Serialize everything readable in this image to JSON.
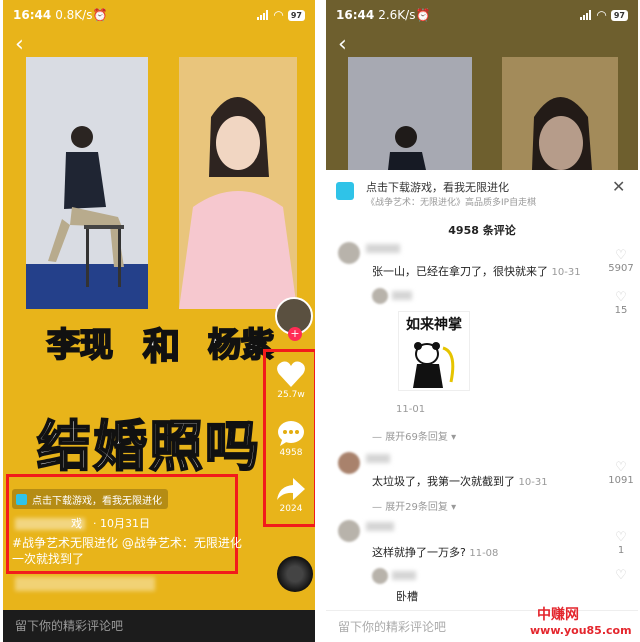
{
  "left": {
    "status": {
      "time": "16:44",
      "speed": "0.8K/s",
      "battery": "97"
    },
    "overlay": {
      "name_a": "李现",
      "and": "和",
      "name_b": "杨紫",
      "title": "结婚照吗"
    },
    "actions": {
      "likes": "25.7w",
      "comments": "4958",
      "shares": "2024"
    },
    "promo": "点击下载游戏，看我无限进化",
    "author_suffix": "戏",
    "date": "· 10月31日",
    "caption_line1": "#战争艺术无限进化 @战争艺术：无限进化",
    "caption_line2": "一次就找到了",
    "comment_placeholder": "留下你的精彩评论吧",
    "colors": {
      "video_bg": "#e3ad10",
      "highlight": "#f21b1b"
    }
  },
  "right": {
    "status": {
      "time": "16:44",
      "speed": "2.6K/s",
      "battery": "97"
    },
    "promo_title": "点击下载游戏，看我无限进化",
    "promo_sub": "《战争艺术：无限进化》高品质多IP自走棋",
    "comment_count": "4958 条评论",
    "comments": [
      {
        "text": "张一山，已经在拿刀了，很快就来了",
        "date": "10-31",
        "likes": "5907"
      },
      {
        "sticker": "如来神掌",
        "date": "11-01",
        "likes": "15",
        "replies": "展开69条回复"
      },
      {
        "text": "太垃圾了，我第一次就截到了",
        "date": "10-31",
        "likes": "1091",
        "replies": "展开29条回复"
      },
      {
        "text": "这样就挣了一万多?",
        "date": "11-08",
        "likes": "1"
      },
      {
        "text": "卧槽"
      }
    ],
    "input_placeholder": "留下你的精彩评论吧"
  },
  "watermark": {
    "brand": "中赚网",
    "url": "www.you85.com"
  }
}
